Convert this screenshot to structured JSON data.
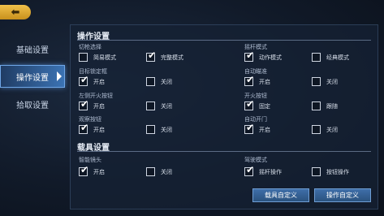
{
  "topbar": {
    "back_glyph": "⬅"
  },
  "sidebar": {
    "items": [
      {
        "label": "基础设置",
        "active": false
      },
      {
        "label": "操作设置",
        "active": true
      },
      {
        "label": "拾取设置",
        "active": false
      }
    ]
  },
  "sections": {
    "operation": {
      "title": "操作设置",
      "groups": [
        {
          "label": "切枪选择",
          "options": [
            {
              "label": "简易模式",
              "checked": false
            },
            {
              "label": "完整模式",
              "checked": true
            }
          ]
        },
        {
          "label": "摇杆模式",
          "options": [
            {
              "label": "动作模式",
              "checked": true
            },
            {
              "label": "经典模式",
              "checked": false
            }
          ]
        },
        {
          "label": "目标锁定框",
          "options": [
            {
              "label": "开启",
              "checked": true
            },
            {
              "label": "关闭",
              "checked": false
            }
          ]
        },
        {
          "label": "自动瞄准",
          "options": [
            {
              "label": "开启",
              "checked": true
            },
            {
              "label": "关闭",
              "checked": false
            }
          ]
        },
        {
          "label": "左侧开火按钮",
          "options": [
            {
              "label": "开启",
              "checked": true
            },
            {
              "label": "关闭",
              "checked": false
            }
          ]
        },
        {
          "label": "开火按钮",
          "options": [
            {
              "label": "固定",
              "checked": true
            },
            {
              "label": "跟随",
              "checked": false
            }
          ]
        },
        {
          "label": "观察按钮",
          "options": [
            {
              "label": "开启",
              "checked": true
            },
            {
              "label": "关闭",
              "checked": false
            }
          ]
        },
        {
          "label": "自动开门",
          "options": [
            {
              "label": "开启",
              "checked": true
            },
            {
              "label": "关闭",
              "checked": false
            }
          ]
        }
      ]
    },
    "vehicle": {
      "title": "载具设置",
      "groups": [
        {
          "label": "智能镜头",
          "options": [
            {
              "label": "开启",
              "checked": true
            },
            {
              "label": "关闭",
              "checked": false
            }
          ]
        },
        {
          "label": "驾驶模式",
          "options": [
            {
              "label": "摇杆操作",
              "checked": true
            },
            {
              "label": "按钮操作",
              "checked": false
            }
          ]
        }
      ]
    }
  },
  "buttons": {
    "vehicle_custom": "载具自定义",
    "operation_custom": "操作自定义"
  },
  "check_glyph": "✔"
}
